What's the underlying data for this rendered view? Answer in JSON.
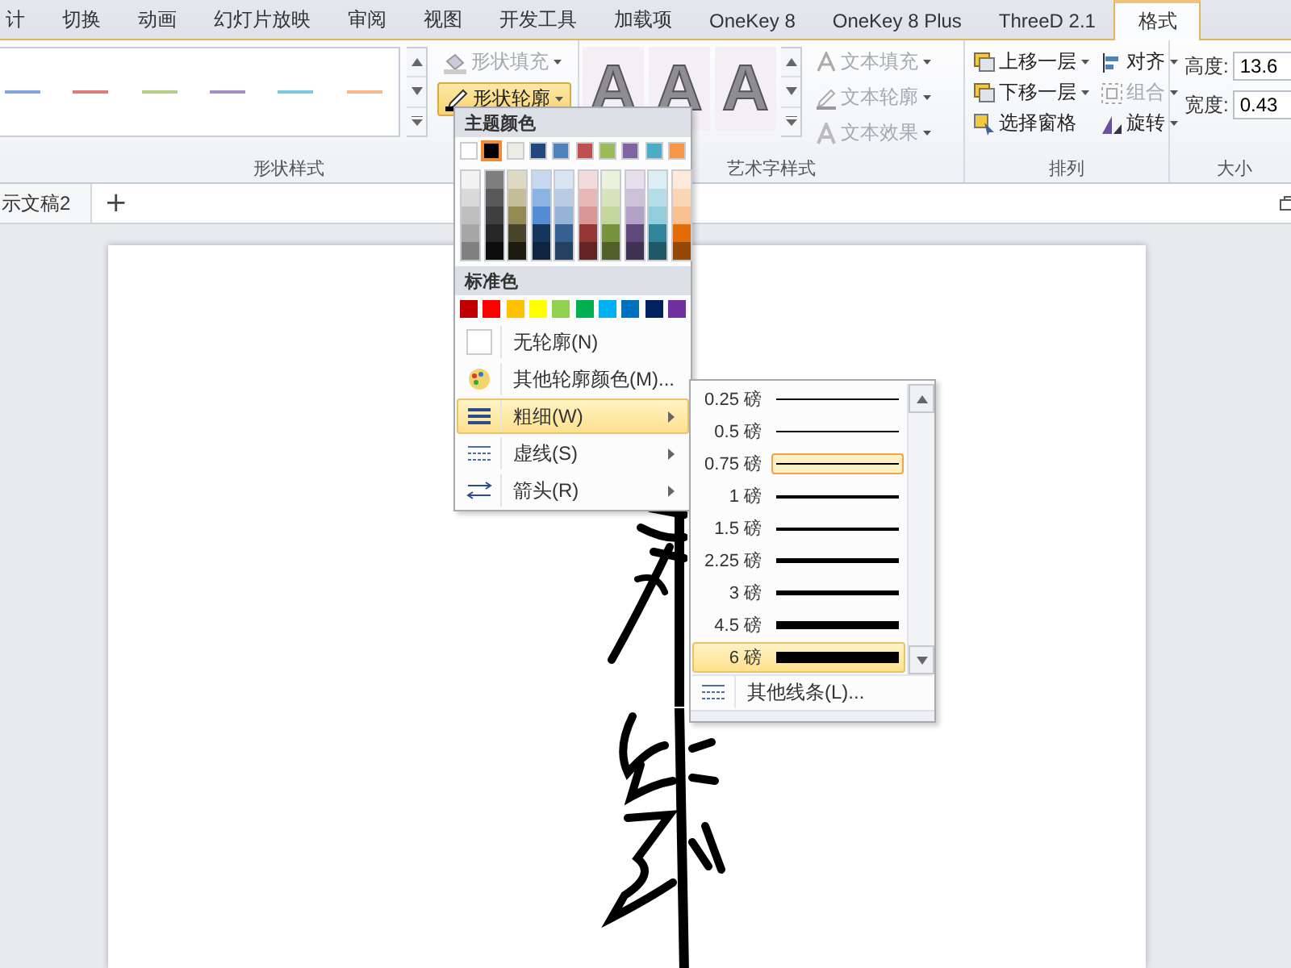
{
  "ribbon_tabs": [
    {
      "label": "计",
      "selected": false
    },
    {
      "label": "切换",
      "selected": false
    },
    {
      "label": "动画",
      "selected": false
    },
    {
      "label": "幻灯片放映",
      "selected": false
    },
    {
      "label": "审阅",
      "selected": false
    },
    {
      "label": "视图",
      "selected": false
    },
    {
      "label": "开发工具",
      "selected": false
    },
    {
      "label": "加载项",
      "selected": false
    },
    {
      "label": "OneKey 8",
      "selected": false
    },
    {
      "label": "OneKey 8 Plus",
      "selected": false
    },
    {
      "label": "ThreeD 2.1",
      "selected": false
    },
    {
      "label": "格式",
      "selected": true
    }
  ],
  "shape_styles": {
    "gallery": [
      {
        "color": "#7fa7d9"
      },
      {
        "color": "#e07b78"
      },
      {
        "color": "#b5cf87"
      },
      {
        "color": "#a48fc3"
      },
      {
        "color": "#7fc9dd"
      },
      {
        "color": "#f8b887"
      }
    ],
    "commands": [
      {
        "label": "形状填充",
        "disabled": true,
        "pressed": false
      },
      {
        "label": "形状轮廓",
        "disabled": false,
        "pressed": true
      }
    ],
    "group_label": "形状样式"
  },
  "wordart_styles": {
    "samples": [
      "A",
      "A",
      "A"
    ],
    "commands": [
      {
        "label": "文本填充",
        "disabled": true
      },
      {
        "label": "文本轮廓",
        "disabled": true
      },
      {
        "label": "文本效果",
        "disabled": true
      }
    ],
    "group_label": "艺术字样式"
  },
  "arrange": {
    "commands": [
      {
        "label": "上移一层",
        "disabled": false,
        "dropdown": true
      },
      {
        "label": "下移一层",
        "disabled": false,
        "dropdown": true
      },
      {
        "label": "选择窗格",
        "disabled": false,
        "dropdown": false
      },
      {
        "label": "对齐",
        "disabled": false,
        "dropdown": true
      },
      {
        "label": "组合",
        "disabled": true,
        "dropdown": true
      },
      {
        "label": "旋转",
        "disabled": false,
        "dropdown": true
      }
    ],
    "group_label": "排列"
  },
  "size": {
    "fields": [
      {
        "label": "高度:",
        "value": "13.6"
      },
      {
        "label": "宽度:",
        "value": "0.43"
      }
    ],
    "group_label": "大小"
  },
  "document_tabs": [
    {
      "label": "示文稿2"
    }
  ],
  "new_tab_button": "+",
  "outline_menu": {
    "theme_header": "主题颜色",
    "theme_colors": [
      {
        "color": "#ffffff",
        "selected": false
      },
      {
        "color": "#000000",
        "selected": true
      },
      {
        "color": "#eeece1",
        "selected": false
      },
      {
        "color": "#1f497d",
        "selected": false
      },
      {
        "color": "#4f81bd",
        "selected": false
      },
      {
        "color": "#c0504d",
        "selected": false
      },
      {
        "color": "#9bbb59",
        "selected": false
      },
      {
        "color": "#8064a2",
        "selected": false
      },
      {
        "color": "#4bacc6",
        "selected": false
      },
      {
        "color": "#f79646",
        "selected": false
      }
    ],
    "shade_columns": [
      {
        "shades": [
          {
            "color": "#f2f2f2"
          },
          {
            "color": "#d9d9d9"
          },
          {
            "color": "#bfbfbf"
          },
          {
            "color": "#a6a6a6"
          },
          {
            "color": "#808080"
          }
        ]
      },
      {
        "shades": [
          {
            "color": "#7f7f7f"
          },
          {
            "color": "#595959"
          },
          {
            "color": "#3f3f3f"
          },
          {
            "color": "#262626"
          },
          {
            "color": "#0d0d0d"
          }
        ]
      },
      {
        "shades": [
          {
            "color": "#ddd9c3"
          },
          {
            "color": "#c4bd97"
          },
          {
            "color": "#938953"
          },
          {
            "color": "#4a442a"
          },
          {
            "color": "#1d1b10"
          }
        ]
      },
      {
        "shades": [
          {
            "color": "#c6d9f0"
          },
          {
            "color": "#8db3e2"
          },
          {
            "color": "#548dd4"
          },
          {
            "color": "#17365d"
          },
          {
            "color": "#0f243e"
          }
        ]
      },
      {
        "shades": [
          {
            "color": "#dbe5f1"
          },
          {
            "color": "#b8cce4"
          },
          {
            "color": "#95b3d7"
          },
          {
            "color": "#366092"
          },
          {
            "color": "#244061"
          }
        ]
      },
      {
        "shades": [
          {
            "color": "#f2dcdb"
          },
          {
            "color": "#e5b9b7"
          },
          {
            "color": "#d99694"
          },
          {
            "color": "#953734"
          },
          {
            "color": "#632423"
          }
        ]
      },
      {
        "shades": [
          {
            "color": "#ebf1dd"
          },
          {
            "color": "#d7e3bc"
          },
          {
            "color": "#c3d69b"
          },
          {
            "color": "#76923c"
          },
          {
            "color": "#4f6128"
          }
        ]
      },
      {
        "shades": [
          {
            "color": "#e5e0ec"
          },
          {
            "color": "#ccc1d9"
          },
          {
            "color": "#b2a2c7"
          },
          {
            "color": "#5f497a"
          },
          {
            "color": "#3f3151"
          }
        ]
      },
      {
        "shades": [
          {
            "color": "#dbeef3"
          },
          {
            "color": "#b7dde8"
          },
          {
            "color": "#92cddc"
          },
          {
            "color": "#31859b"
          },
          {
            "color": "#205867"
          }
        ]
      },
      {
        "shades": [
          {
            "color": "#fdeada"
          },
          {
            "color": "#fbd5b5"
          },
          {
            "color": "#fac08f"
          },
          {
            "color": "#e36c09"
          },
          {
            "color": "#974806"
          }
        ]
      }
    ],
    "standard_header": "标准色",
    "standard_colors": [
      {
        "color": "#c00000"
      },
      {
        "color": "#ff0000"
      },
      {
        "color": "#ffc000"
      },
      {
        "color": "#ffff00"
      },
      {
        "color": "#92d050"
      },
      {
        "color": "#00b050"
      },
      {
        "color": "#00b0f0"
      },
      {
        "color": "#0070c0"
      },
      {
        "color": "#002060"
      },
      {
        "color": "#7030a0"
      }
    ],
    "items": [
      {
        "kind": "none",
        "label": "无轮廓(N)",
        "submenu": false,
        "highlighted": false
      },
      {
        "kind": "palette",
        "label": "其他轮廓颜色(M)...",
        "submenu": false,
        "highlighted": false
      },
      {
        "kind": "weight",
        "label": "粗细(W)",
        "submenu": true,
        "highlighted": true
      },
      {
        "kind": "dash",
        "label": "虚线(S)",
        "submenu": true,
        "highlighted": false
      },
      {
        "kind": "arrows",
        "label": "箭头(R)",
        "submenu": true,
        "highlighted": false
      }
    ]
  },
  "weight_submenu": {
    "items": [
      {
        "label": "0.25 磅",
        "selected": false,
        "hovered": false
      },
      {
        "label": "0.5 磅",
        "selected": false,
        "hovered": false
      },
      {
        "label": "0.75 磅",
        "selected": true,
        "hovered": false
      },
      {
        "label": "1 磅",
        "selected": false,
        "hovered": false
      },
      {
        "label": "1.5 磅",
        "selected": false,
        "hovered": false
      },
      {
        "label": "2.25 磅",
        "selected": false,
        "hovered": false
      },
      {
        "label": "3 磅",
        "selected": false,
        "hovered": false
      },
      {
        "label": "4.5 磅",
        "selected": false,
        "hovered": false
      },
      {
        "label": "6 磅",
        "selected": false,
        "hovered": true
      }
    ],
    "more": "其他线条(L)..."
  }
}
